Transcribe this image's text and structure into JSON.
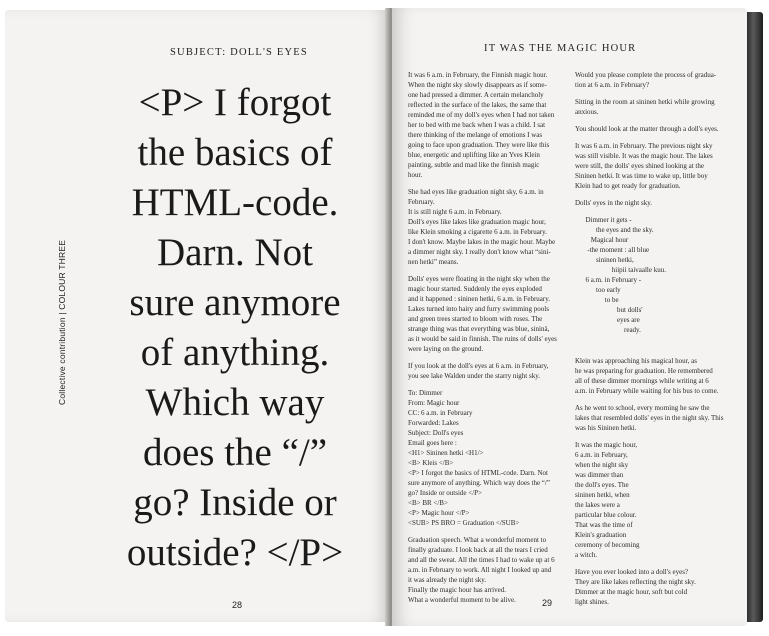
{
  "left_page": {
    "running_head": "SUBJECT: DOLL'S EYES",
    "side_label": "Collective contribution | COLOUR THREE",
    "quote_lines": [
      "<P> I forgot",
      "the basics of",
      "HTML-code.",
      "Darn. Not",
      "sure anymore",
      "of anything.",
      "Which way",
      "does the “/”",
      "go? Inside or",
      "outside? </P>"
    ],
    "page_number": "28"
  },
  "right_page": {
    "running_head": "IT WAS THE MAGIC HOUR",
    "page_number": "29",
    "col1": [
      "It was 6 a.m. in February, the Finnish magic hour.",
      "When the night sky slowly disappears as if some-",
      "one had pressed a dimmer. A certain melancholy",
      "reflected in the surface of the lakes, the same that",
      "reminded me of my doll's eyes when I had not taken",
      "her to bed with me back when I was a child. I sat",
      "there thinking of the melange of emotions I was",
      "going to face upon graduation. They were like this",
      "blue, energetic and uplifting like an Yves Klein",
      "painting, subtle and mad like the finnish magic",
      "hour.",
      "",
      "She had eyes like graduation night sky, 6 a.m. in",
      "February.",
      "It is still night 6 a.m. in February.",
      "Doll's eyes like lakes like graduation magic hour,",
      "like Klein smoking a cigarette 6 a.m. in February.",
      "I don't know. Maybe lakes in the magic hour. Maybe",
      "a dimmer night sky. I really don't know what “sini-",
      "nen hetki” means.",
      "",
      "Dolls' eyes were floating in the night sky when the",
      "magic hour started. Suddenly the eyes exploded",
      "and it happened : sininen hetki, 6 a.m. in February.",
      "Lakes turned into hairy and furry swimming pools",
      "and green trees started to bloom with roses. The",
      "strange thing was that everything was blue, sininä,",
      "as it would be said in finnish. The ruins of dolls' eyes",
      "were laying on the ground.",
      "",
      "If you look at the doll's eyes at 6 a.m. in February,",
      "you see lake Walden under the starry night sky.",
      "",
      "To: Dimmer",
      "From: Magic hour",
      "CC: 6 a.m. in February",
      "Forwarded: Lakes",
      "Subject: Doll's eyes",
      "Email goes here :",
      "<H1> Sininen hetki <H1/>",
      "<B> Kleis </B>",
      "<P> I forgot the basics of HTML-code. Darn. Not",
      "sure anymore of anything. Which way does the “/”",
      "go? Inside or outside </P>",
      "<B> BR </B>",
      "<P> Magic hour </P>",
      "<SUB> PS BRO = Graduation </SUB>",
      "",
      "Graduation speech. What a wonderful moment to",
      "finally graduate. I look back at all the tears I cried",
      "and all the sweat. All the times I had to wake up at 6",
      "a.m. in February to work. All night I looked up and",
      "it was already the night sky.",
      "Finally the magic hour has arrived.",
      "What a wonderful moment to be alive."
    ],
    "col2": [
      "Would you please complete the process of gradua-",
      "tion at 6 a.m. in February?",
      "",
      "Sitting in the room at sininen hetki while growing",
      "anxious.",
      "",
      "You should look at the matter through a doll's eyes.",
      "",
      "It was 6 a.m. in February. The previous night sky",
      "was still visible. It was the magic hour. The lakes",
      "were still, the dolls' eyes shined looking at the",
      "Sininen hetki. It was time to wake up, little boy",
      "Klein had to get ready for graduation.",
      "",
      "Dolls' eyes in the night sky.",
      "",
      "      Dimmer it gets -",
      "            the eyes and the sky.",
      "         Magical hour",
      "       -the moment : all blue",
      "            sininen hetki,",
      "                     hiipii taivaalle kuu.",
      "      6 a.m. in February -",
      "            too early",
      "                 to be",
      "                        but dolls'",
      "                        eyes are",
      "                            ready.",
      "",
      "",
      "",
      "Klein was approaching his magical hour, as",
      "he was preparing for graduation. He remembered",
      "all of these dimmer mornings while writing at 6",
      "a.m. in February while waiting for his bus to come.",
      "",
      "As he went to school, every morning he saw the",
      "lakes that resembled dolls' eyes in the night sky. This",
      "was his Sininen hetki.",
      "",
      "It was the magic hour,",
      "6 a.m. in February,",
      "when the night sky",
      "was dimmer than",
      "the doll's eyes. The",
      "sininen hetki, when",
      "the lakes were a",
      "particular blue colour.",
      "That was the time of",
      "Klein's graduation",
      "ceremony of becoming",
      "a witch.",
      "",
      "Have you ever looked into a doll's eyes?",
      "They are like lakes reflecting the night sky.",
      "Dimmer at the magic hour, soft but cold",
      "light shines."
    ]
  }
}
